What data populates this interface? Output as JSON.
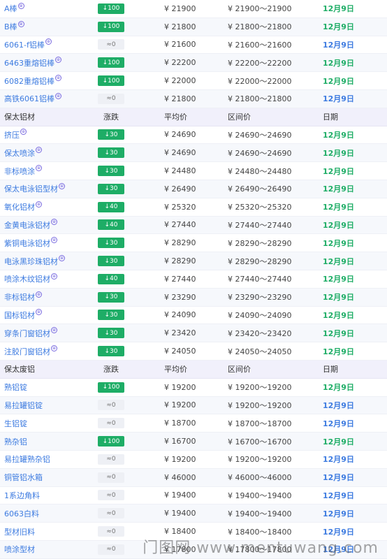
{
  "sections": [
    {
      "header": null,
      "rows": [
        {
          "name": "A棒",
          "change": "↓100",
          "trend": "down",
          "avg": "¥ 21900",
          "range": "¥ 21900～21900",
          "date": "12月9日",
          "date_color": "green"
        },
        {
          "name": "B棒",
          "change": "↓100",
          "trend": "down",
          "avg": "¥ 21800",
          "range": "¥ 21800～21800",
          "date": "12月9日",
          "date_color": "green"
        },
        {
          "name": "6061-f铝棒",
          "change": "≈0",
          "trend": "flat",
          "avg": "¥ 21600",
          "range": "¥ 21600～21600",
          "date": "12月9日",
          "date_color": "blue"
        },
        {
          "name": "6463重熔铝棒",
          "change": "↓100",
          "trend": "down",
          "avg": "¥ 22200",
          "range": "¥ 22200～22200",
          "date": "12月9日",
          "date_color": "green"
        },
        {
          "name": "6082重熔铝棒",
          "change": "↓100",
          "trend": "down",
          "avg": "¥ 22000",
          "range": "¥ 22000～22000",
          "date": "12月9日",
          "date_color": "green"
        },
        {
          "name": "高铁6061铝棒",
          "change": "≈0",
          "trend": "flat",
          "avg": "¥ 21800",
          "range": "¥ 21800～21800",
          "date": "12月9日",
          "date_color": "blue"
        }
      ]
    },
    {
      "header": {
        "name": "保太铝材",
        "change": "涨跌",
        "avg": "平均价",
        "range": "区间价",
        "date": "日期"
      },
      "rows": [
        {
          "name": "挤压",
          "change": "↓30",
          "trend": "down",
          "avg": "¥ 24690",
          "range": "¥ 24690～24690",
          "date": "12月9日",
          "date_color": "green"
        },
        {
          "name": "保太喷涂",
          "change": "↓30",
          "trend": "down",
          "avg": "¥ 24690",
          "range": "¥ 24690～24690",
          "date": "12月9日",
          "date_color": "green"
        },
        {
          "name": "非标喷涂",
          "change": "↓30",
          "trend": "down",
          "avg": "¥ 24480",
          "range": "¥ 24480～24480",
          "date": "12月9日",
          "date_color": "green"
        },
        {
          "name": "保太电泳铝型材",
          "change": "↓30",
          "trend": "down",
          "avg": "¥ 26490",
          "range": "¥ 26490～26490",
          "date": "12月9日",
          "date_color": "green"
        },
        {
          "name": "氧化铝材",
          "change": "↓40",
          "trend": "down",
          "avg": "¥ 25320",
          "range": "¥ 25320～25320",
          "date": "12月9日",
          "date_color": "green"
        },
        {
          "name": "金黄电泳铝材",
          "change": "↓40",
          "trend": "down",
          "avg": "¥ 27440",
          "range": "¥ 27440～27440",
          "date": "12月9日",
          "date_color": "green"
        },
        {
          "name": "紫铜电泳铝材",
          "change": "↓30",
          "trend": "down",
          "avg": "¥ 28290",
          "range": "¥ 28290～28290",
          "date": "12月9日",
          "date_color": "green"
        },
        {
          "name": "电泳黑珍珠铝材",
          "change": "↓30",
          "trend": "down",
          "avg": "¥ 28290",
          "range": "¥ 28290～28290",
          "date": "12月9日",
          "date_color": "green"
        },
        {
          "name": "喷涂木纹铝材",
          "change": "↓40",
          "trend": "down",
          "avg": "¥ 27440",
          "range": "¥ 27440～27440",
          "date": "12月9日",
          "date_color": "green"
        },
        {
          "name": "非标铝材",
          "change": "↓30",
          "trend": "down",
          "avg": "¥ 23290",
          "range": "¥ 23290～23290",
          "date": "12月9日",
          "date_color": "green"
        },
        {
          "name": "国标铝材",
          "change": "↓30",
          "trend": "down",
          "avg": "¥ 24090",
          "range": "¥ 24090～24090",
          "date": "12月9日",
          "date_color": "green"
        },
        {
          "name": "穿条门窗铝材",
          "change": "↓30",
          "trend": "down",
          "avg": "¥ 23420",
          "range": "¥ 23420～23420",
          "date": "12月9日",
          "date_color": "green"
        },
        {
          "name": "注胶门窗铝材",
          "change": "↓30",
          "trend": "down",
          "avg": "¥ 24050",
          "range": "¥ 24050～24050",
          "date": "12月9日",
          "date_color": "green"
        }
      ]
    },
    {
      "header": {
        "name": "保太废铝",
        "change": "涨跌",
        "avg": "平均价",
        "range": "区间价",
        "date": "日期"
      },
      "rows": [
        {
          "name": "熟铝锭",
          "change": "↓100",
          "trend": "down",
          "avg": "¥ 19200",
          "range": "¥ 19200～19200",
          "date": "12月9日",
          "date_color": "green"
        },
        {
          "name": "易拉罐铝锭",
          "change": "≈0",
          "trend": "flat",
          "avg": "¥ 19200",
          "range": "¥ 19200～19200",
          "date": "12月9日",
          "date_color": "blue"
        },
        {
          "name": "生铝锭",
          "change": "≈0",
          "trend": "flat",
          "avg": "¥ 18700",
          "range": "¥ 18700～18700",
          "date": "12月9日",
          "date_color": "blue"
        },
        {
          "name": "熟杂铝",
          "change": "↓100",
          "trend": "down",
          "avg": "¥ 16700",
          "range": "¥ 16700～16700",
          "date": "12月9日",
          "date_color": "green"
        },
        {
          "name": "易拉罐熟杂铝",
          "change": "≈0",
          "trend": "flat",
          "avg": "¥ 19200",
          "range": "¥ 19200～19200",
          "date": "12月9日",
          "date_color": "blue"
        },
        {
          "name": "铜管铝水箱",
          "change": "≈0",
          "trend": "flat",
          "avg": "¥ 46000",
          "range": "¥ 46000～46000",
          "date": "12月9日",
          "date_color": "blue"
        },
        {
          "name": "1系边角料",
          "change": "≈0",
          "trend": "flat",
          "avg": "¥ 19400",
          "range": "¥ 19400～19400",
          "date": "12月9日",
          "date_color": "blue"
        },
        {
          "name": "6063白料",
          "change": "≈0",
          "trend": "flat",
          "avg": "¥ 19400",
          "range": "¥ 19400～19400",
          "date": "12月9日",
          "date_color": "blue"
        },
        {
          "name": "型材旧料",
          "change": "≈0",
          "trend": "flat",
          "avg": "¥ 18400",
          "range": "¥ 18400～18400",
          "date": "12月9日",
          "date_color": "blue"
        },
        {
          "name": "喷涂型材",
          "change": "≈0",
          "trend": "flat",
          "avg": "¥ 17800",
          "range": "¥ 17800～17800",
          "date": "12月9日",
          "date_color": "blue"
        }
      ]
    }
  ],
  "linked_names": [
    "A棒",
    "B棒",
    "6061-f铝棒",
    "6463重熔铝棒",
    "6082重熔铝棒",
    "高铁6061铝棒",
    "挤压",
    "保太喷涂",
    "非标喷涂",
    "保太电泳铝型材",
    "氧化铝材",
    "金黄电泳铝材",
    "紫铜电泳铝材",
    "电泳黑珍珠铝材",
    "喷涂木纹铝材",
    "非标铝材",
    "国标铝材",
    "穿条门窗铝材",
    "注胶门窗铝材"
  ],
  "watermark": "门图网 www.mentuwang.com",
  "colors": {
    "down": "#1ead66",
    "flat": "#eef0f5",
    "link": "#3d7be0",
    "date_green": "#1ead66",
    "date_blue": "#3d7be0"
  }
}
